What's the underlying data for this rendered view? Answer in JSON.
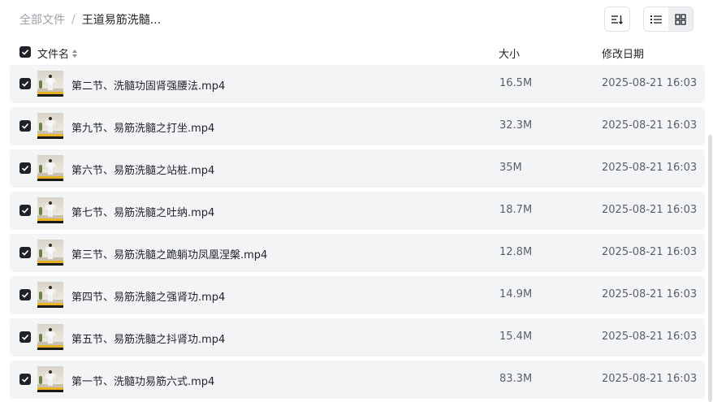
{
  "breadcrumb": {
    "root": "全部文件",
    "separator": "/",
    "current": "王道易筋洗髓..."
  },
  "toolbar": {
    "sort_icon": "sort-icon",
    "list_view_icon": "list-view-icon",
    "grid_view_icon": "grid-view-icon",
    "active_view": "grid"
  },
  "columns": {
    "name": "文件名",
    "size": "大小",
    "modified": "修改日期"
  },
  "files": [
    {
      "name": "第二节、洗髓功固肾强腰法.mp4",
      "size": "16.5M",
      "modified": "2025-08-21 16:03"
    },
    {
      "name": "第九节、易筋洗髓之打坐.mp4",
      "size": "32.3M",
      "modified": "2025-08-21 16:03"
    },
    {
      "name": "第六节、易筋洗髓之站桩.mp4",
      "size": "35M",
      "modified": "2025-08-21 16:03"
    },
    {
      "name": "第七节、易筋洗髓之吐纳.mp4",
      "size": "18.7M",
      "modified": "2025-08-21 16:03"
    },
    {
      "name": "第三节、易筋洗髓之跪躺功凤凰涅槃.mp4",
      "size": "12.8M",
      "modified": "2025-08-21 16:03"
    },
    {
      "name": "第四节、易筋洗髓之强肾功.mp4",
      "size": "14.9M",
      "modified": "2025-08-21 16:03"
    },
    {
      "name": "第五节、易筋洗髓之抖肾功.mp4",
      "size": "15.4M",
      "modified": "2025-08-21 16:03"
    },
    {
      "name": "第一节、洗髓功易筋六式.mp4",
      "size": "83.3M",
      "modified": "2025-08-21 16:03"
    }
  ],
  "colors": {
    "checkbox": "#1f2329",
    "row_background": "#f3f4f6",
    "thumbnail_band": "#e8b323"
  }
}
